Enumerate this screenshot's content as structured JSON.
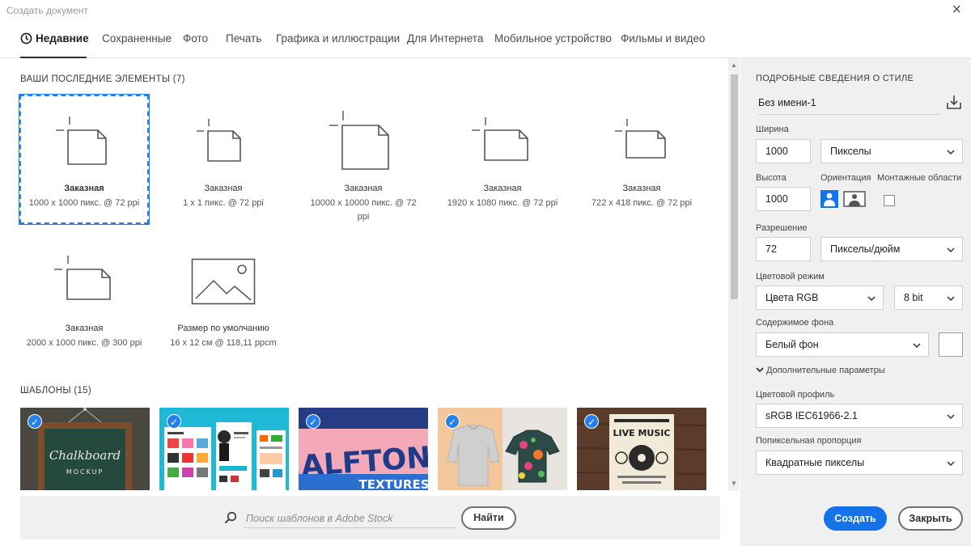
{
  "window": {
    "title": "Создать документ",
    "close_label": "×"
  },
  "tabs": [
    {
      "label": "Недавние",
      "active": true
    },
    {
      "label": "Сохраненные"
    },
    {
      "label": "Фото"
    },
    {
      "label": "Печать"
    },
    {
      "label": "Графика и иллюстрации"
    },
    {
      "label": "Для Интернета"
    },
    {
      "label": "Мобильное устройство"
    },
    {
      "label": "Фильмы и видео"
    }
  ],
  "recent": {
    "title": "ВАШИ ПОСЛЕДНИЕ ЭЛЕМЕНТЫ",
    "count": "(7)",
    "items": [
      {
        "name": "Заказная",
        "dims": "1000 x 1000 пикс. @ 72 ppi",
        "icon": "custom-document-icon",
        "selected": true
      },
      {
        "name": "Заказная",
        "dims": "1 x 1 пикс. @ 72 ppi",
        "icon": "custom-document-icon"
      },
      {
        "name": "Заказная",
        "dims": "10000 x 10000 пикс. @ 72 ppi",
        "icon": "custom-document-icon"
      },
      {
        "name": "Заказная",
        "dims": "1920 x 1080 пикс. @ 72 ppi",
        "icon": "custom-document-icon"
      },
      {
        "name": "Заказная",
        "dims": "722 x 418 пикс. @ 72 ppi",
        "icon": "custom-document-icon"
      },
      {
        "name": "Заказная",
        "dims": "2000 x 1000 пикс. @ 300 ppi",
        "icon": "custom-document-icon"
      },
      {
        "name": "Размер по умолчанию",
        "dims": "16 x 12 см @ 118,11 ppcm",
        "icon": "image-placeholder-icon"
      }
    ]
  },
  "templates": {
    "title": "ШАБЛОНЫ",
    "count": "(15)",
    "items": [
      {
        "name": "chalkboard-mockup",
        "text1": "Chalkboard",
        "text2": "MOCKUP"
      },
      {
        "name": "web-ecommerce-template"
      },
      {
        "name": "halftone-textures",
        "text1": "HALFTONE",
        "text2": "TEXTURES"
      },
      {
        "name": "apparel-mockup"
      },
      {
        "name": "live-music-poster",
        "text1": "LIVE MUSIC"
      }
    ]
  },
  "search": {
    "placeholder": "Поиск шаблонов в Adobe Stock",
    "button": "Найти"
  },
  "details": {
    "title": "ПОДРОБНЫЕ СВЕДЕНИЯ О СТИЛЕ",
    "doc_name": "Без имени-1",
    "width_label": "Ширина",
    "width_value": "1000",
    "width_unit": "Пикселы",
    "height_label": "Высота",
    "height_value": "1000",
    "orientation_label": "Ориентация",
    "artboards_label": "Монтажные области",
    "resolution_label": "Разрешение",
    "resolution_value": "72",
    "resolution_unit": "Пикселы/дюйм",
    "color_mode_label": "Цветовой режим",
    "color_mode_value": "Цвета RGB",
    "bit_depth": "8 bit",
    "background_label": "Содержимое фона",
    "background_value": "Белый фон",
    "background_color": "#ffffff",
    "advanced_label": "Дополнительные параметры",
    "profile_label": "Цветовой профиль",
    "profile_value": "sRGB IEC61966-2.1",
    "pixel_aspect_label": "Попиксельная пропорция",
    "pixel_aspect_value": "Квадратные пикселы"
  },
  "actions": {
    "create": "Создать",
    "close": "Закрыть"
  },
  "colors": {
    "accent": "#1473e6",
    "selection": "#2680eb"
  }
}
